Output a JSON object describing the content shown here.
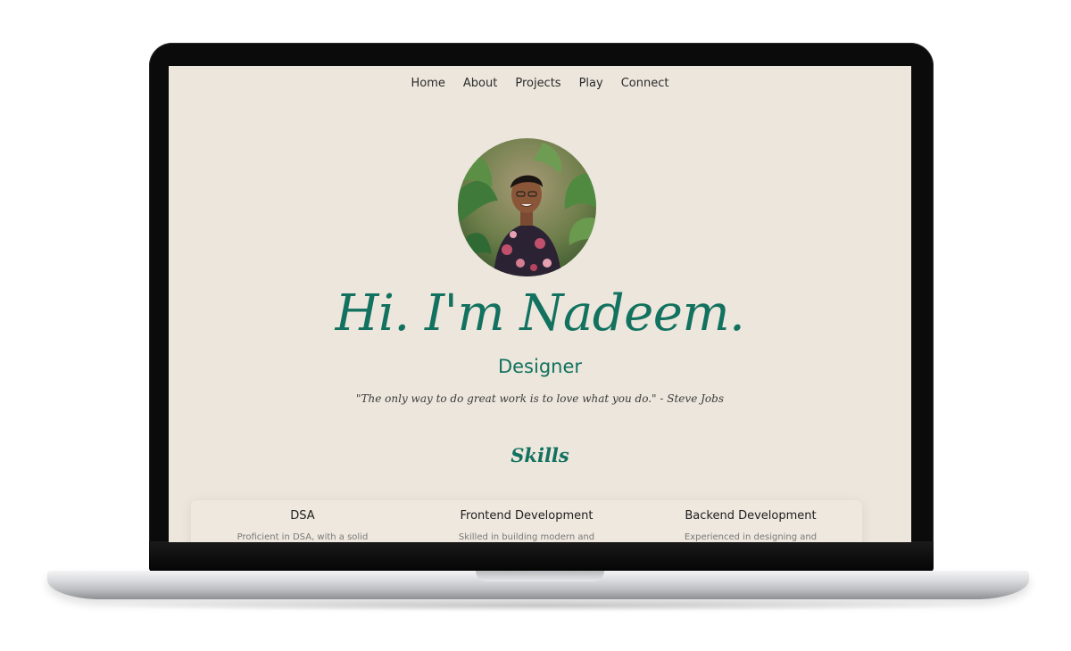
{
  "nav": {
    "items": [
      {
        "label": "Home"
      },
      {
        "label": "About"
      },
      {
        "label": "Projects"
      },
      {
        "label": "Play"
      },
      {
        "label": "Connect"
      }
    ]
  },
  "hero": {
    "avatar_icon": "profile-photo",
    "title": "Hi. I'm Nadeem.",
    "subtitle": "Designer",
    "quote": "\"The only way to do great work is to love what you do.\" - Steve Jobs"
  },
  "skills": {
    "heading": "Skills",
    "items": [
      {
        "title": "DSA",
        "desc": "Proficient in DSA, with a solid"
      },
      {
        "title": "Frontend Development",
        "desc": "Skilled in building modern and"
      },
      {
        "title": "Backend Development",
        "desc": "Experienced in designing and"
      }
    ]
  },
  "colors": {
    "accent": "#12715f",
    "page_background": "#ece6dc",
    "text": "#2b2b2b"
  }
}
